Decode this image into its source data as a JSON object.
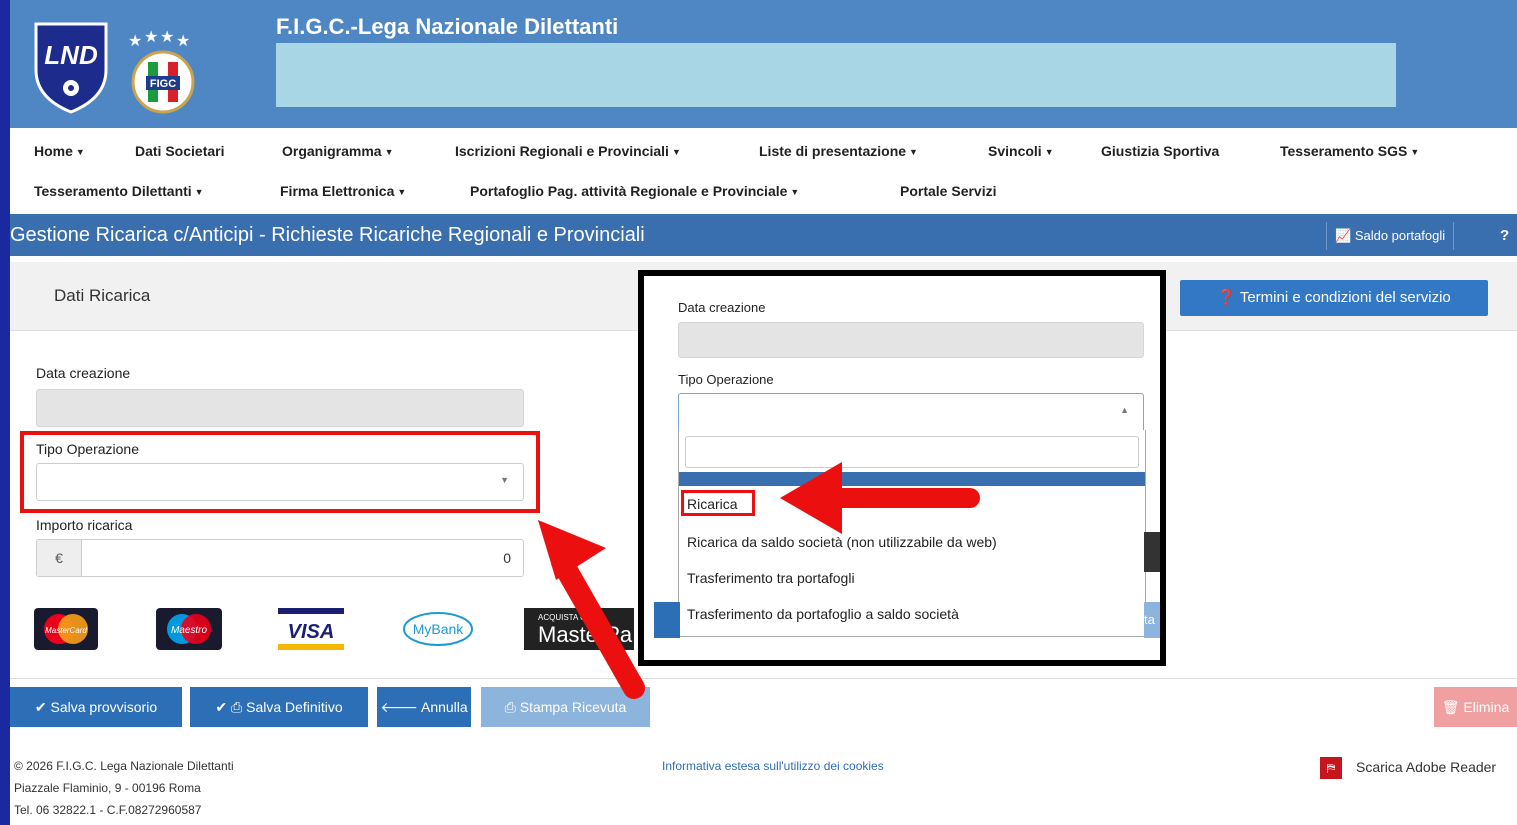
{
  "header": {
    "title": "F.I.G.C.-Lega Nazionale Dilettanti",
    "logo_lnd_text": "LND",
    "logo_figc_text": "FIGC"
  },
  "nav": {
    "row1": [
      {
        "label": "Home",
        "dropdown": true
      },
      {
        "label": "Dati Societari",
        "dropdown": false
      },
      {
        "label": "Organigramma",
        "dropdown": true
      },
      {
        "label": "Iscrizioni Regionali e Provinciali",
        "dropdown": true
      },
      {
        "label": "Liste di presentazione",
        "dropdown": true
      },
      {
        "label": "Svincoli",
        "dropdown": true
      },
      {
        "label": "Giustizia Sportiva",
        "dropdown": false
      },
      {
        "label": "Tesseramento SGS",
        "dropdown": true
      }
    ],
    "row2": [
      {
        "label": "Tesseramento Dilettanti",
        "dropdown": true
      },
      {
        "label": "Firma Elettronica",
        "dropdown": true
      },
      {
        "label": "Portafoglio Pag. attività Regionale e Provinciale",
        "dropdown": true
      },
      {
        "label": "Portale Servizi",
        "dropdown": false
      }
    ]
  },
  "titlebar": {
    "title": "Gestione Ricarica c/Anticipi - Richieste Ricariche Regionali e Provinciali",
    "saldo_label": "Saldo portafogli",
    "help_glyph": "?"
  },
  "panel": {
    "heading": "Dati Ricarica",
    "terms_label": "Termini e condizioni del servizio"
  },
  "form": {
    "data_creazione_label": "Data creazione",
    "tipo_operazione_label": "Tipo Operazione",
    "importo_label": "Importo ricarica",
    "currency_symbol": "€",
    "importo_value": "0"
  },
  "payment_logos": [
    "MasterCard",
    "Maestro",
    "VISA",
    "MyBank",
    "MasterPass"
  ],
  "masterpass_top": "ACQUISTA CON",
  "masterpass_main": "MasterPa",
  "actions": {
    "salva_provvisorio": "Salva provvisorio",
    "salva_definitivo": "Salva Definitivo",
    "annulla": "Annulla",
    "stampa_ricevuta": "Stampa Ricevuta",
    "elimina": "Elimina"
  },
  "footer": {
    "line1": "© 2026 F.I.G.C. Lega Nazionale Dilettanti",
    "line2": "Piazzale Flaminio, 9 - 00196 Roma",
    "line3": "Tel. 06 32822.1 - C.F.08272960587",
    "cookies": "Informativa estesa sull'utilizzo dei cookies",
    "adobe": "Scarica Adobe Reader"
  },
  "popup": {
    "data_creazione_label": "Data creazione",
    "tipo_operazione_label": "Tipo Operazione",
    "options": [
      "Ricarica",
      "Ricarica da saldo società (non utilizzabile da web)",
      "Trasferimento tra portafogli",
      "Trasferimento da portafoglio a saldo società"
    ],
    "bg_button_fragment": "ta"
  },
  "colors": {
    "header_blue": "#4f87c4",
    "titlebar_blue": "#3a6faf",
    "button_blue": "#2d6fb7",
    "highlight_red": "#ec0f0f",
    "frame_blue": "#1a2a9e"
  }
}
